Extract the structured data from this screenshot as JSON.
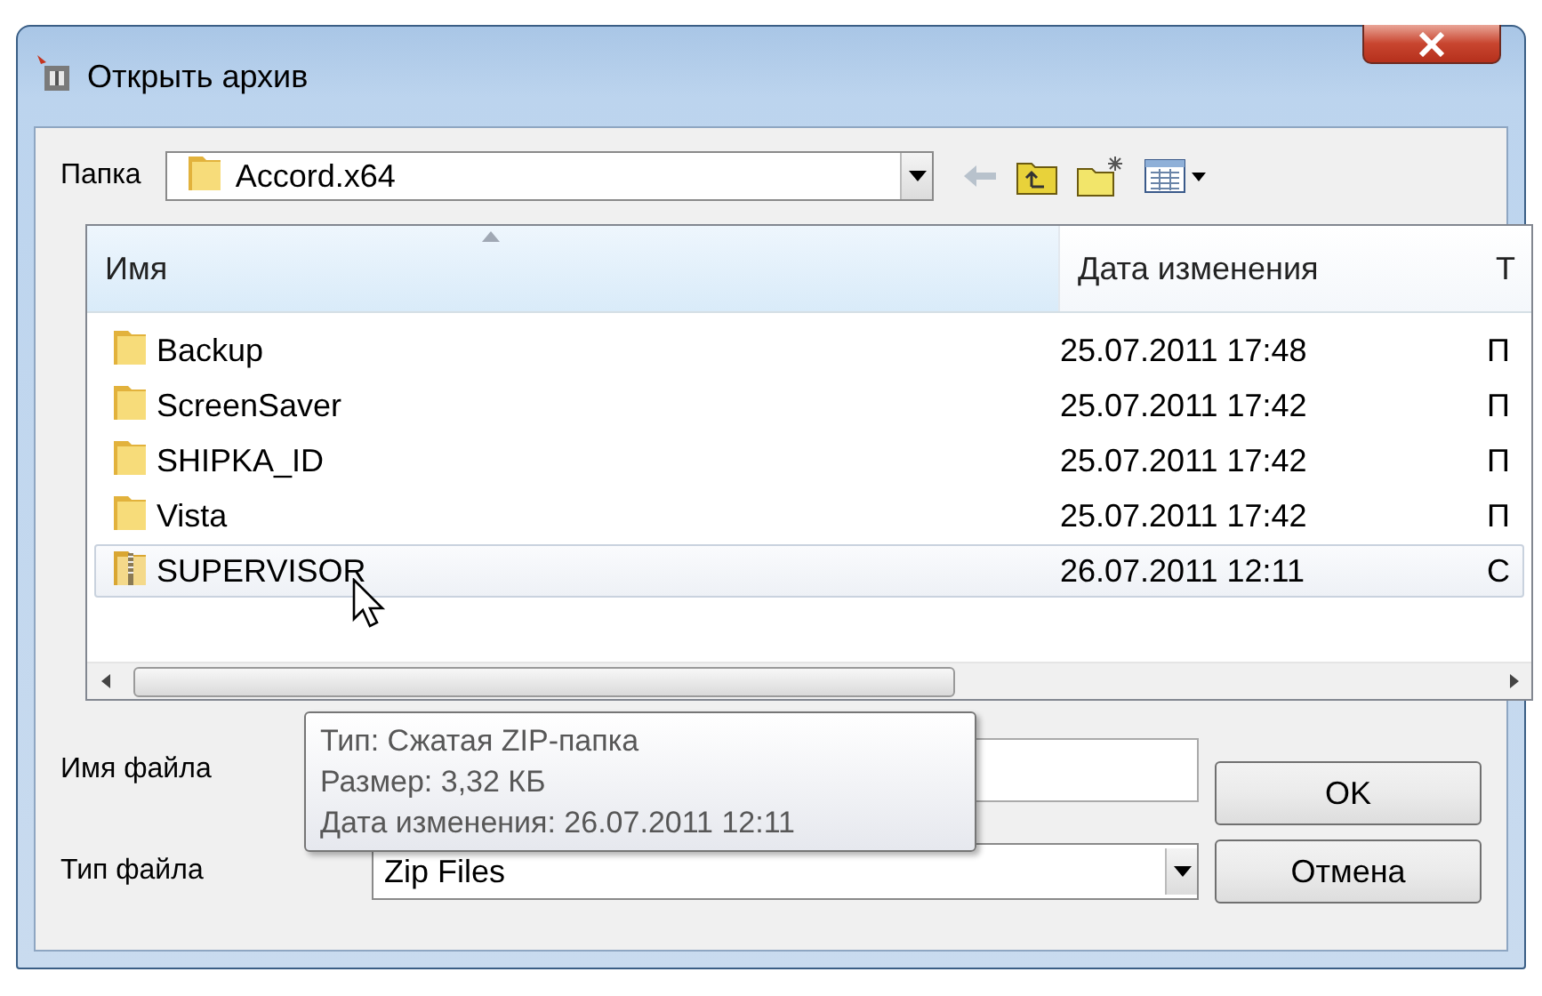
{
  "window": {
    "title": "Открыть архив"
  },
  "look_in": {
    "label": "Папка",
    "value": "Accord.x64"
  },
  "file_list": {
    "columns": [
      "Имя",
      "Дата изменения",
      "Т"
    ],
    "rows": [
      {
        "name": "Backup",
        "date": "25.07.2011 17:48",
        "type": "П",
        "kind": "folder",
        "selected": false
      },
      {
        "name": "ScreenSaver",
        "date": "25.07.2011 17:42",
        "type": "П",
        "kind": "folder",
        "selected": false
      },
      {
        "name": "SHIPKA_ID",
        "date": "25.07.2011 17:42",
        "type": "П",
        "kind": "folder",
        "selected": false
      },
      {
        "name": "Vista",
        "date": "25.07.2011 17:42",
        "type": "П",
        "kind": "folder",
        "selected": false
      },
      {
        "name": "SUPERVISOR",
        "date": "26.07.2011 12:11",
        "type": "С",
        "kind": "zip",
        "selected": true
      }
    ]
  },
  "tooltip": {
    "lines": [
      "Тип: Сжатая ZIP-папка",
      "Размер: 3,32 КБ",
      "Дата изменения: 26.07.2011 12:11"
    ]
  },
  "file_name": {
    "label": "Имя файла"
  },
  "file_type": {
    "label": "Тип файла",
    "value": "Zip Files"
  },
  "buttons": [
    {
      "label": "OK"
    },
    {
      "label": "Отмена"
    }
  ]
}
